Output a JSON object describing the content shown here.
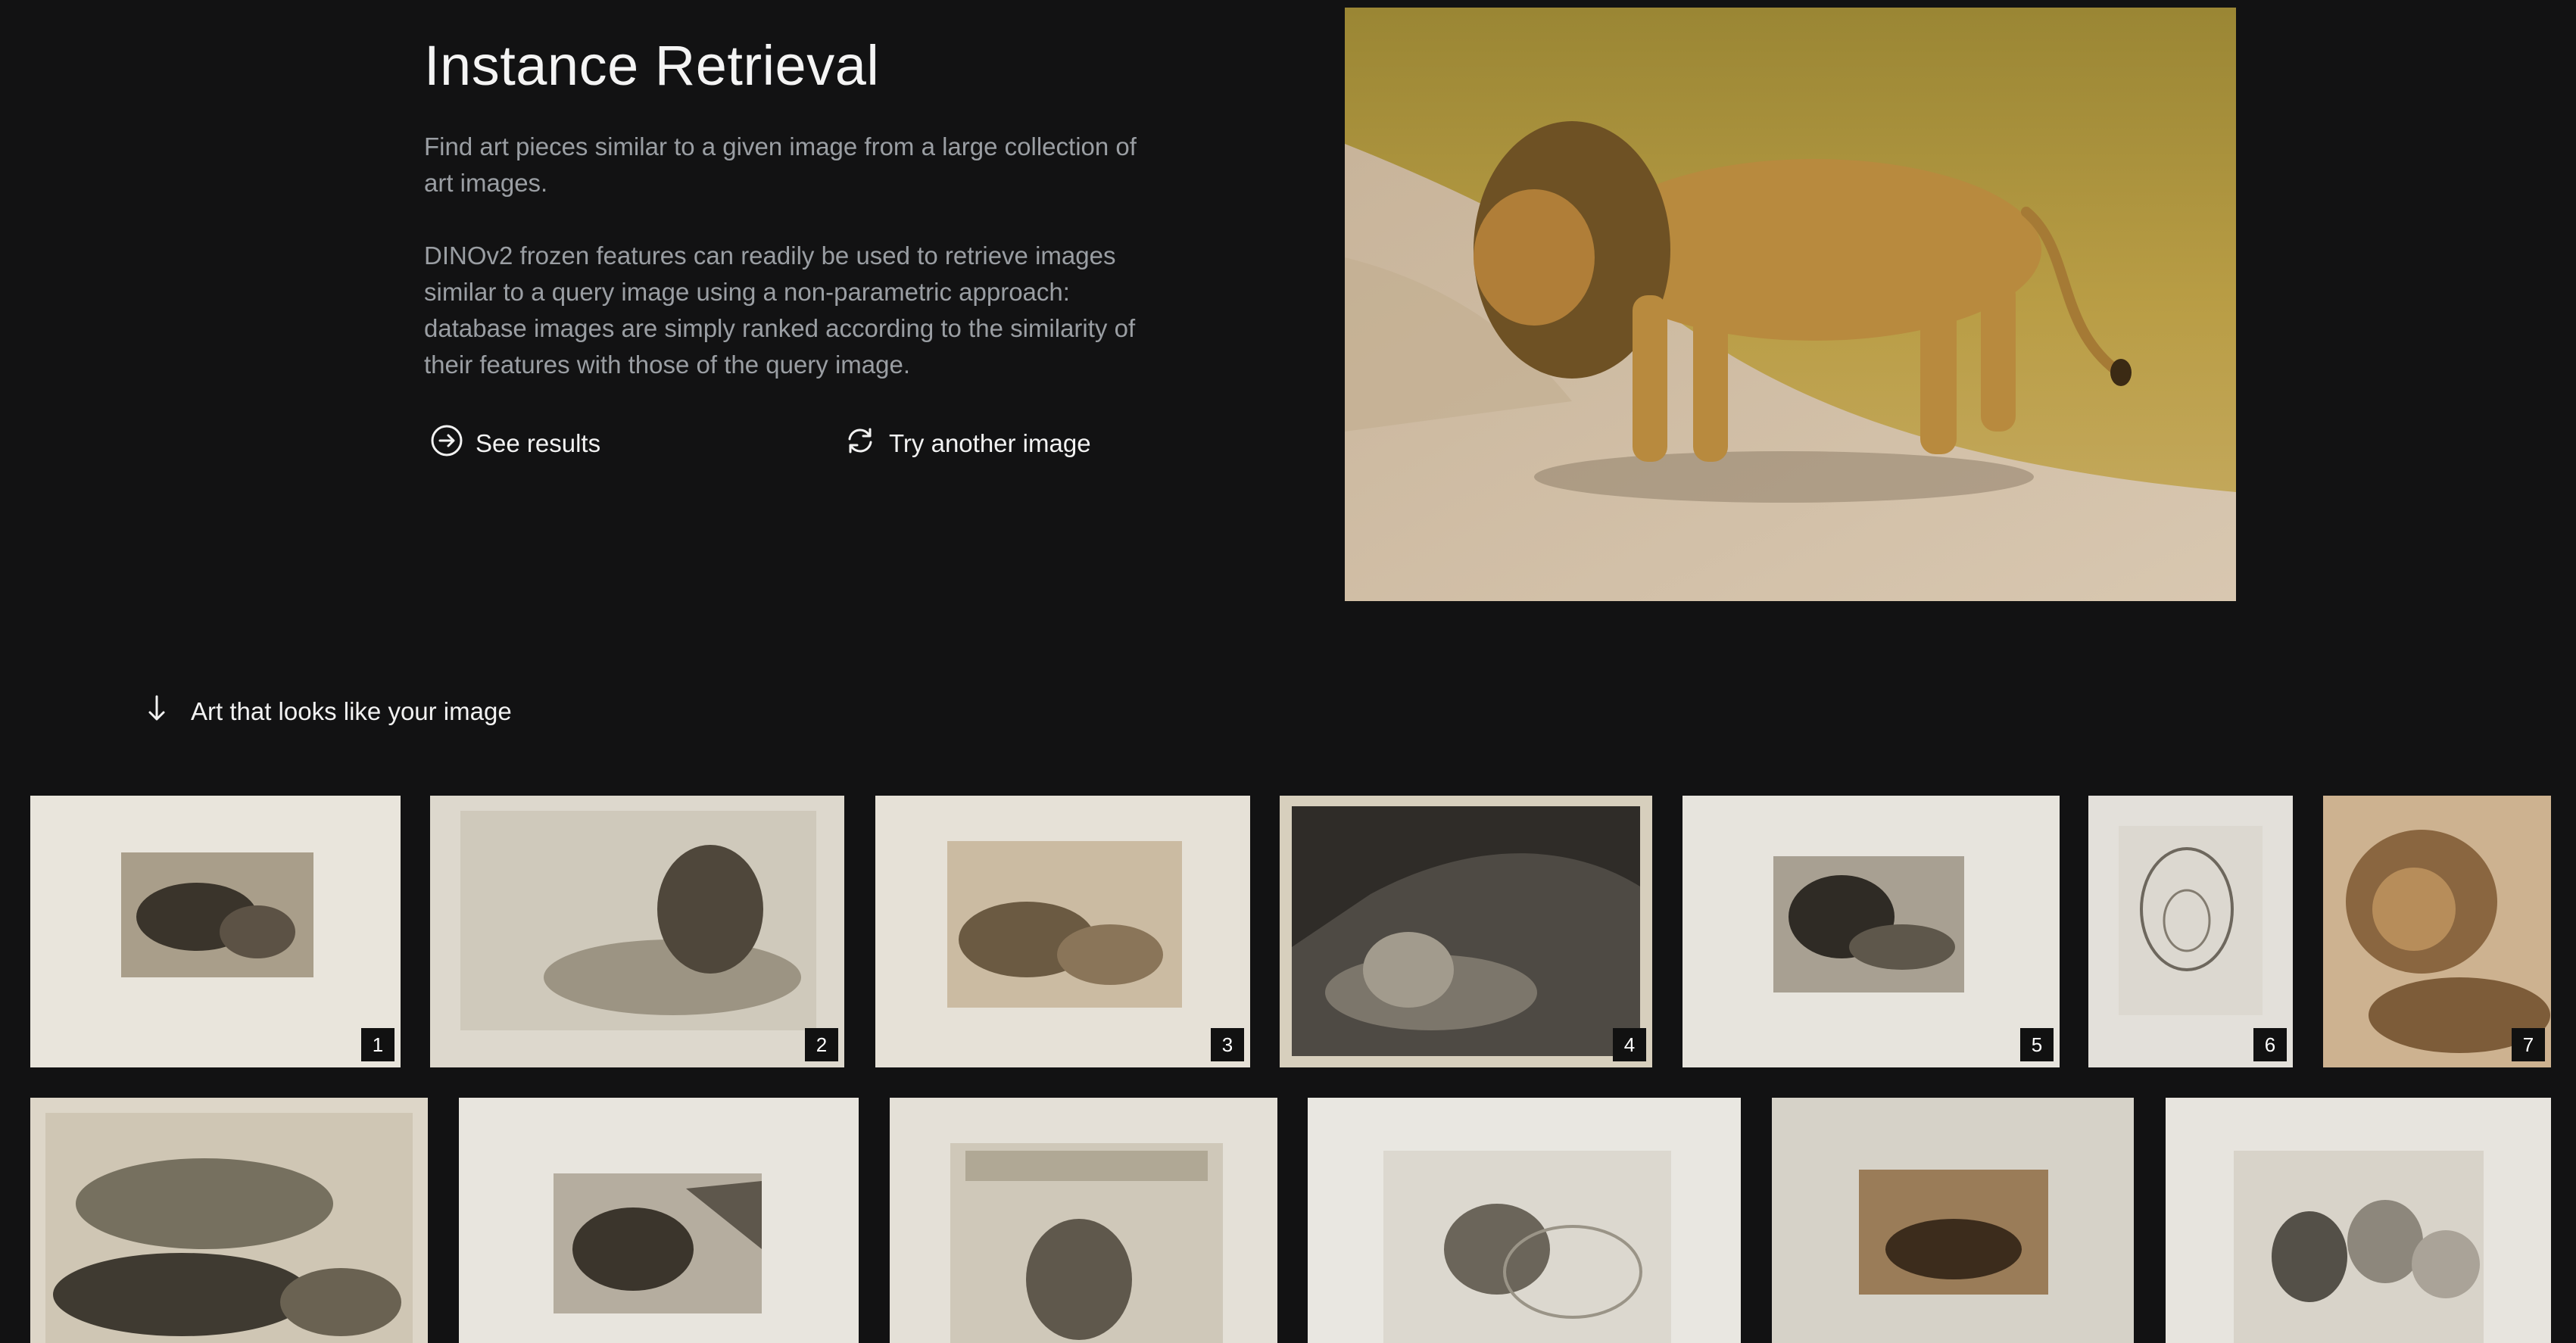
{
  "header": {
    "title": "Instance Retrieval",
    "description_1": "Find art pieces similar to a given image from a large collection of art images.",
    "description_2": "DINOv2 frozen features can readily be used to retrieve images similar to a query image using a non-parametric approach: database images are simply ranked according to the similarity of their features with those of the query image."
  },
  "actions": {
    "see_results": {
      "label": "See results",
      "icon": "arrow-right-circle-icon"
    },
    "try_another": {
      "label": "Try another image",
      "icon": "refresh-icon"
    }
  },
  "section": {
    "heading": "Art that looks like your image",
    "icon": "arrow-down-icon"
  },
  "results": [
    {
      "rank": "1"
    },
    {
      "rank": "2"
    },
    {
      "rank": "3"
    },
    {
      "rank": "4"
    },
    {
      "rank": "5"
    },
    {
      "rank": "6"
    },
    {
      "rank": "7"
    }
  ],
  "colors": {
    "background": "#121213",
    "text": "#f4f4f4",
    "muted_text": "#9a9ea3"
  }
}
